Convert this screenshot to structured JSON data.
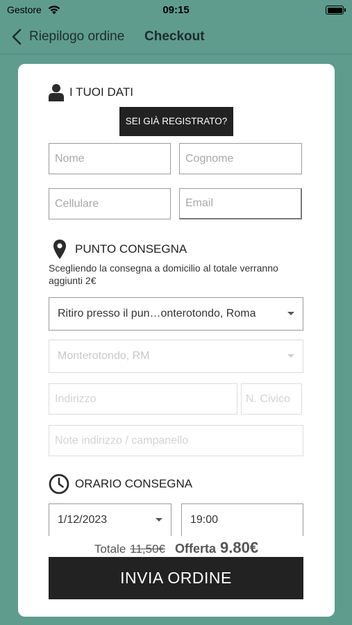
{
  "status_bar": {
    "carrier": "Gestore",
    "time": "09:15"
  },
  "nav": {
    "back_label": "Riepilogo ordine",
    "title": "Checkout"
  },
  "personal": {
    "title": "I TUOI DATI",
    "registered_button": "SEI GIÀ REGISTRATO?",
    "first_name_placeholder": "Nome",
    "last_name_placeholder": "Cognome",
    "phone_placeholder": "Cellulare",
    "email_placeholder": "Email"
  },
  "delivery": {
    "title": "PUNTO CONSEGNA",
    "note": "Scegliendo la consegna a domicilio al totale verranno aggiunti 2€",
    "pickup_select": "Ritiro presso il pun…onterotondo, Roma",
    "city_select": "Monterotondo, RM",
    "address_placeholder": "Indirizzo",
    "number_placeholder": "N. Civico",
    "notes_placeholder": "Note indirizzo / campanello"
  },
  "schedule": {
    "title": "ORARIO CONSEGNA",
    "date": "1/12/2023",
    "time": "19:00"
  },
  "summary": {
    "total_label": "Totale",
    "total_old": "11,50€",
    "offer_label": "Offerta",
    "offer_value": "9.80€"
  },
  "submit_label": "INVIA ORDINE"
}
